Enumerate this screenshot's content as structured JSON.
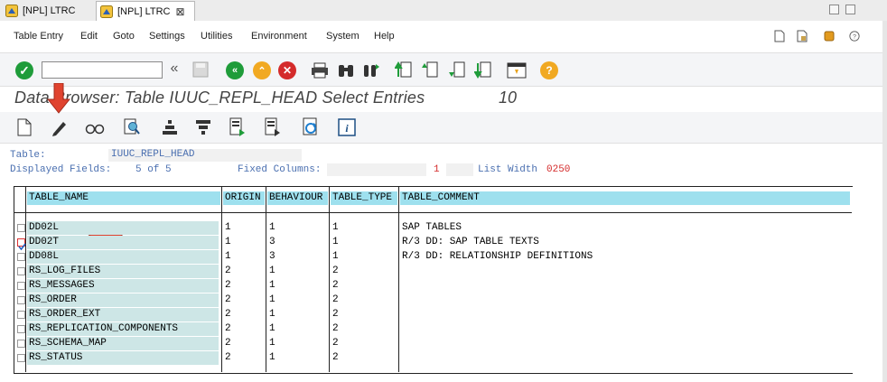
{
  "tabs": [
    {
      "label": "[NPL] LTRC",
      "active": false
    },
    {
      "label": "[NPL] LTRC",
      "active": true,
      "close": "⊠"
    }
  ],
  "menu": [
    "Table Entry",
    "Edit",
    "Goto",
    "Settings",
    "Utilities",
    "Environment",
    "System",
    "Help"
  ],
  "command_field": {
    "value": "",
    "placeholder": ""
  },
  "header": {
    "title": "Data Browser: Table IUUC_REPL_HEAD Select Entries",
    "count": "10"
  },
  "info": {
    "table_label": "Table:",
    "table_value": "IUUC_REPL_HEAD",
    "displayed_label": "Displayed Fields:",
    "displayed_value": "5 of    5",
    "fixed_label": "Fixed Columns:",
    "fixed_value": "1",
    "width_label": "List Width",
    "width_value": "0250"
  },
  "columns": [
    "TABLE_NAME",
    "ORIGIN",
    "BEHAVIOUR",
    "TABLE_TYPE",
    "TABLE_COMMENT"
  ],
  "rows": [
    {
      "checked": false,
      "name": "DD02L",
      "origin": "1",
      "behaviour": "1",
      "type": "1",
      "comment": "SAP TABLES"
    },
    {
      "checked": true,
      "name": "DD02T",
      "origin": "1",
      "behaviour": "3",
      "type": "1",
      "comment": "R/3 DD: SAP TABLE TEXTS"
    },
    {
      "checked": false,
      "name": "DD08L",
      "origin": "1",
      "behaviour": "3",
      "type": "1",
      "comment": "R/3 DD: RELATIONSHIP DEFINITIONS"
    },
    {
      "checked": false,
      "name": "RS_LOG_FILES",
      "origin": "2",
      "behaviour": "1",
      "type": "2",
      "comment": ""
    },
    {
      "checked": false,
      "name": "RS_MESSAGES",
      "origin": "2",
      "behaviour": "1",
      "type": "2",
      "comment": ""
    },
    {
      "checked": false,
      "name": "RS_ORDER",
      "origin": "2",
      "behaviour": "1",
      "type": "2",
      "comment": ""
    },
    {
      "checked": false,
      "name": "RS_ORDER_EXT",
      "origin": "2",
      "behaviour": "1",
      "type": "2",
      "comment": ""
    },
    {
      "checked": false,
      "name": "RS_REPLICATION_COMPONENTS",
      "origin": "2",
      "behaviour": "1",
      "type": "2",
      "comment": ""
    },
    {
      "checked": false,
      "name": "RS_SCHEMA_MAP",
      "origin": "2",
      "behaviour": "1",
      "type": "2",
      "comment": ""
    },
    {
      "checked": false,
      "name": "RS_STATUS",
      "origin": "2",
      "behaviour": "1",
      "type": "2",
      "comment": ""
    }
  ],
  "colors": {
    "header_cell": "#9ee0ee",
    "name_cell": "#cde6e6",
    "accent_red": "#e0432f",
    "ok_green": "#1f9c3a"
  }
}
